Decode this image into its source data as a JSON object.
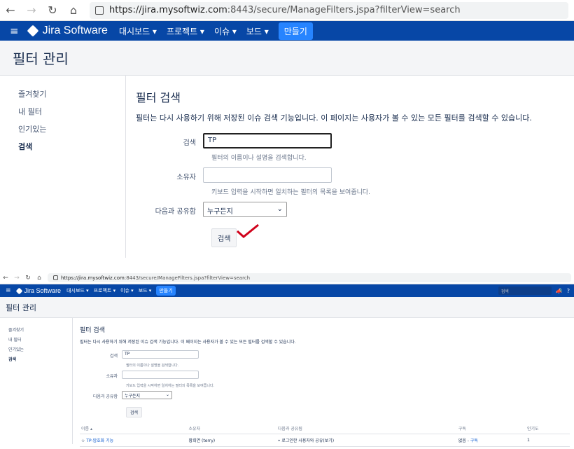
{
  "browser": {
    "url_host": "https://jira.mysoftwiz.com",
    "url_rest": ":8443/secure/ManageFilters.jspa?filterView=search"
  },
  "header": {
    "logo": "Jira Software",
    "menu": [
      "대시보드 ▾",
      "프로젝트 ▾",
      "이슈 ▾",
      "보드 ▾"
    ],
    "create": "만들기",
    "search_placeholder": "검색"
  },
  "page_title": "필터 관리",
  "sidebar": {
    "items": [
      "즐겨찾기",
      "내 필터",
      "인기있는",
      "검색"
    ]
  },
  "main": {
    "heading": "필터 검색",
    "description": "필터는 다시 사용하기 위해 저장된 이슈 검색 기능입니다. 이 페이지는 사용자가 볼 수 있는 모든 필터를 검색할 수 있습니다.",
    "search_label": "검색",
    "search_value": "TP",
    "search_hint": "필터의 이름이나 설명을 검색합니다.",
    "owner_label": "소유자",
    "owner_hint": "키보드 입력을 시작하면 일치하는 필터의 목록을 보여줍니다.",
    "share_label": "다음과 공유함",
    "share_value": "누구든지",
    "search_button": "검색"
  },
  "results": {
    "columns": [
      "이름 ▴",
      "소유자",
      "다음과 공유됨",
      "구독",
      "인기도"
    ],
    "rows": [
      {
        "name": "TP-암호화 기능",
        "owner": "황희연 (terry)",
        "shared": "로그인한 사용자와 공유(보기)",
        "sub_none": "없음",
        "sub_link": "구독",
        "popularity": "1"
      }
    ]
  },
  "colors": {
    "header": "#0747a6",
    "create": "#2684ff",
    "check": "#d0021b"
  }
}
